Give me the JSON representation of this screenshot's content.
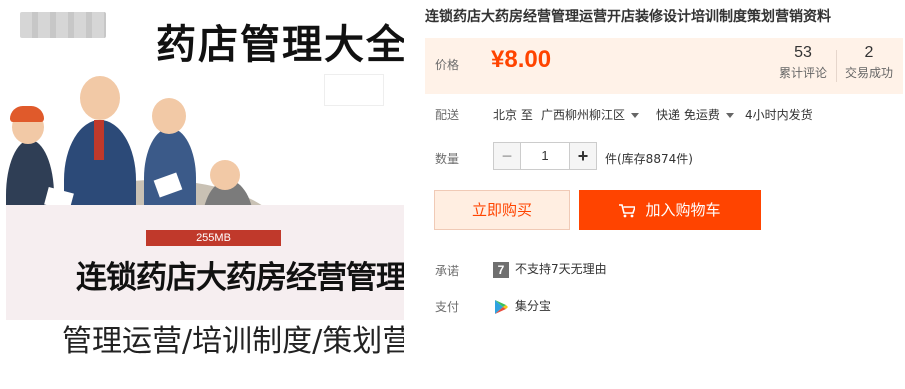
{
  "image": {
    "big_title": "药店管理大全",
    "size_badge": "255MB",
    "main_caption": "连锁药店大药房经营管理运营",
    "sub_caption": "管理运营/培训制度/策划营销"
  },
  "product": {
    "title": "连锁药店大药房经营管理运营开店装修设计培训制度策划营销资料",
    "price_label": "价格",
    "price": "¥8.00",
    "reviews_count": "53",
    "reviews_label": "累计评论",
    "deals_count": "2",
    "deals_label": "交易成功"
  },
  "shipping": {
    "label": "配送",
    "from": "北京 至",
    "to": "广西柳州柳江区",
    "method": "快递 免运费",
    "dispatch": "4小时内发货"
  },
  "quantity": {
    "label": "数量",
    "minus": "−",
    "value": "1",
    "plus": "+",
    "unit_stock": "件(库存8874件)"
  },
  "actions": {
    "buy_now": "立即购买",
    "add_to_cart": "加入购物车"
  },
  "promise": {
    "label": "承诺",
    "icon_text": "7",
    "text": "不支持7天无理由"
  },
  "payment": {
    "label": "支付",
    "method": "集分宝"
  },
  "colors": {
    "accent": "#ff4400",
    "price_bg": "#fff2e8"
  }
}
